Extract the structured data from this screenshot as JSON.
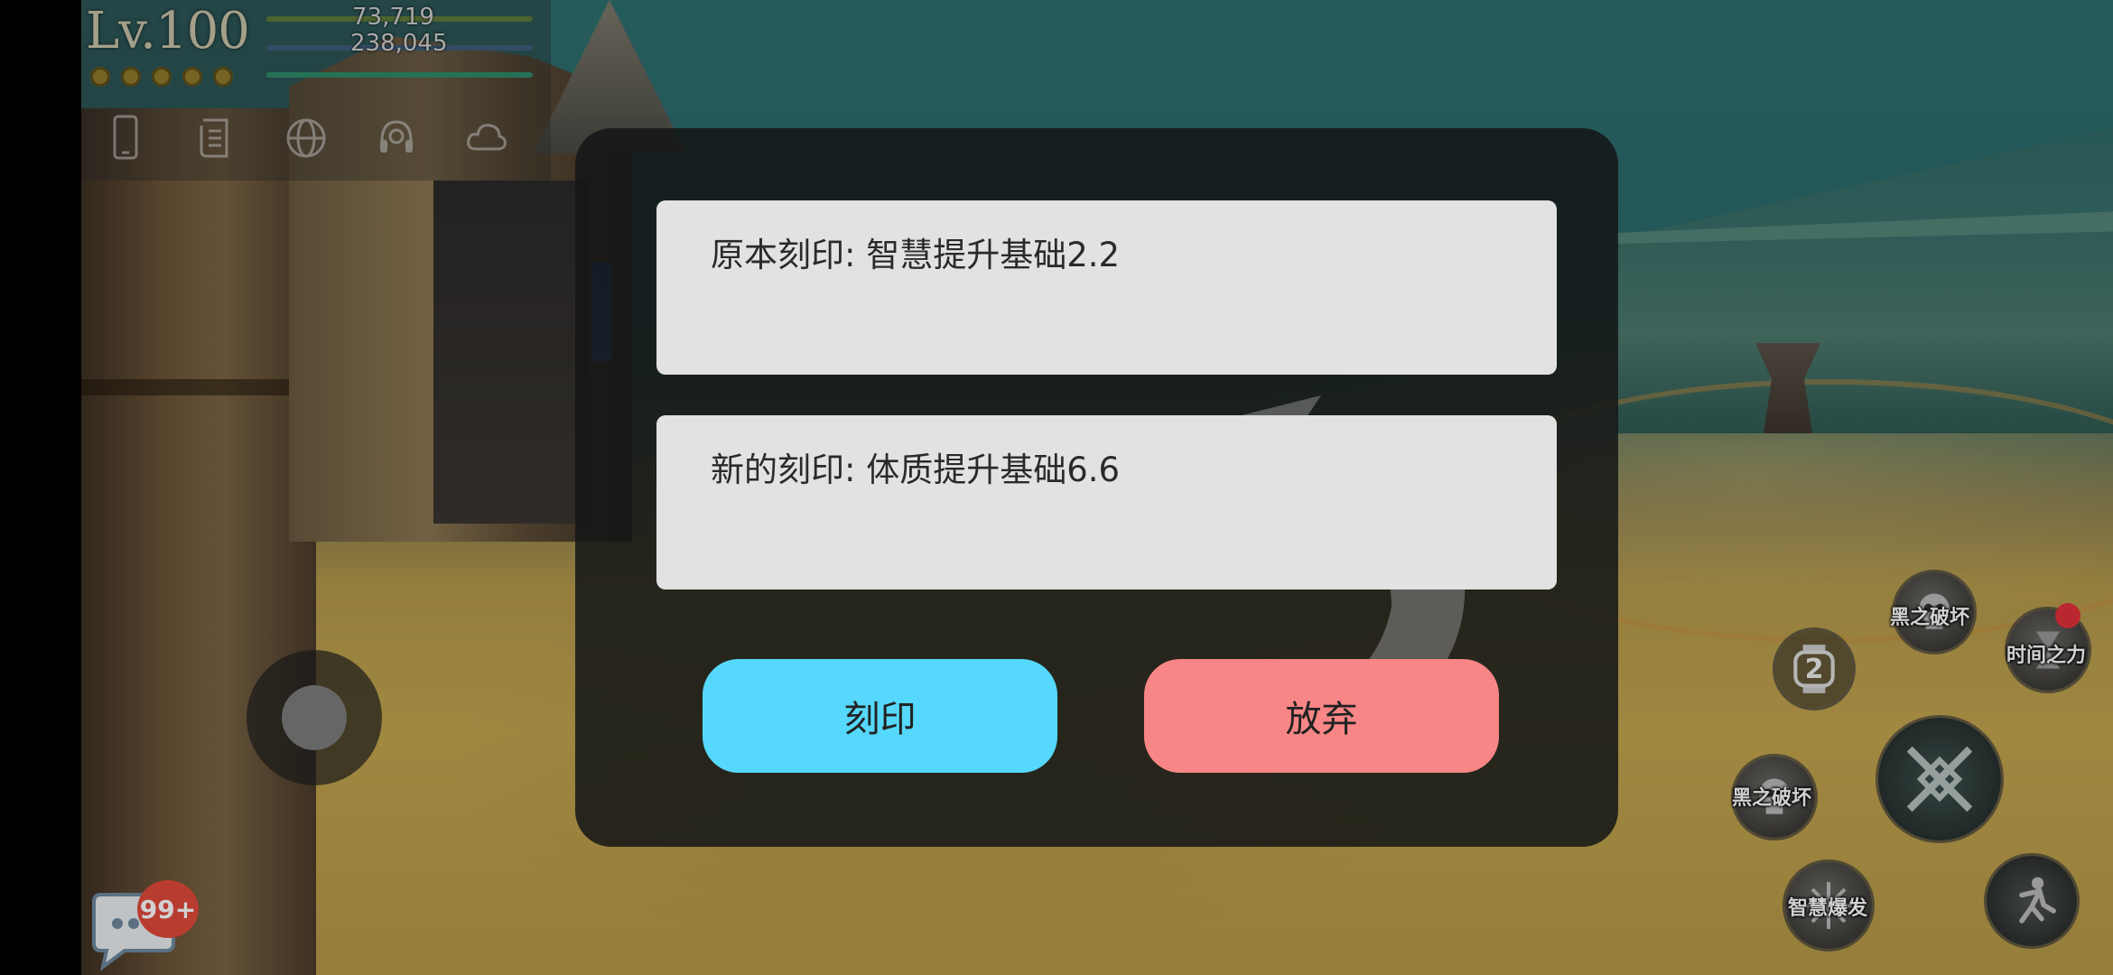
{
  "hud": {
    "level": "Lv.100",
    "hp": "73,719",
    "mp": "238,045",
    "dot_count": 5,
    "icons": [
      "phone-icon",
      "scroll-icon",
      "globe-icon",
      "headset-icon",
      "cloud-icon"
    ]
  },
  "chat": {
    "badge": "99+"
  },
  "skills": {
    "skill_1": "黑之破坏",
    "skill_2": "时间之力",
    "watch_count": "2",
    "skill_3": "黑之破坏",
    "skill_4": "智慧爆发"
  },
  "dialog": {
    "original_engraving": "原本刻印: 智慧提升基础2.2",
    "new_engraving": "新的刻印: 体质提升基础6.6",
    "engrave_button": "刻印",
    "abandon_button": "放弃"
  },
  "colors": {
    "engrave_button": "#55d8fb",
    "abandon_button": "#f98686",
    "badge": "#e24a3c"
  }
}
